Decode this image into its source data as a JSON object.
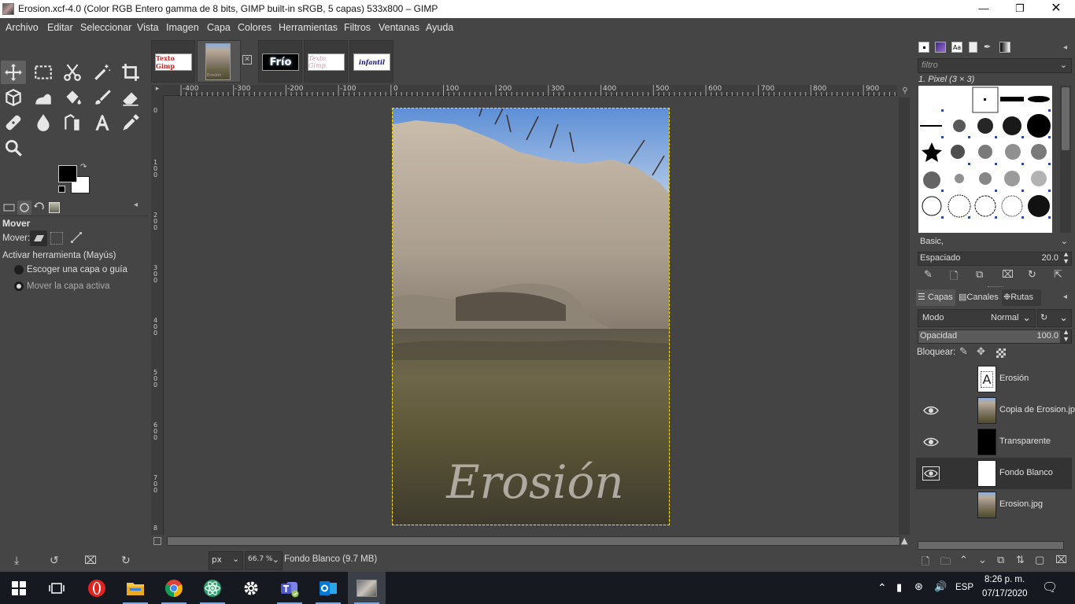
{
  "window": {
    "title": "Erosion.xcf-4.0 (Color RGB Entero gamma de 8 bits, GIMP built-in sRGB, 5 capas) 533x800 – GIMP",
    "minimize_icon": "minimize-icon",
    "maximize_icon": "restore-icon",
    "close_icon": "close-icon"
  },
  "menu": [
    "Archivo",
    "Editar",
    "Seleccionar",
    "Vista",
    "Imagen",
    "Capa",
    "Colores",
    "Herramientas",
    "Filtros",
    "Ventanas",
    "Ayuda"
  ],
  "toolbox": {
    "tools": [
      "move-tool-icon",
      "rect-select-icon",
      "scissors-select-icon",
      "fuzzy-select-icon",
      "crop-icon",
      "unified-transform-icon",
      "warp-transform-icon",
      "bucket-fill-icon",
      "paintbrush-icon",
      "eraser-icon",
      "heal-icon",
      "smudge-icon",
      "paths-icon",
      "text-tool-icon",
      "color-picker-icon",
      "zoom-icon"
    ],
    "fg_color": "#000000",
    "bg_color": "#ffffff"
  },
  "tool_options": {
    "title": "Mover",
    "mover_label": "Mover:",
    "activate_label": "Activar herramienta  (Mayús)",
    "option_pick": "Escoger una capa o guía",
    "option_active": "Mover la capa activa",
    "selected_option": "Mover la capa activa"
  },
  "image_tabs": {
    "tab1": "Texto Gimp",
    "tab2": "Erosión",
    "tab3": "Frío",
    "tab4": "Texto Gimp",
    "tab5": "infantil"
  },
  "rulers": {
    "h_ticks": [
      "-400",
      "-300",
      "-200",
      "-100",
      "0",
      "100",
      "200",
      "300",
      "400",
      "500",
      "600",
      "700",
      "800",
      "900"
    ],
    "v_ticks": [
      "0",
      "1\n0\n0",
      "2\n0\n0",
      "3\n0\n0",
      "4\n0\n0",
      "5\n0\n0",
      "6\n0\n0",
      "7\n0\n0",
      "8"
    ]
  },
  "canvas": {
    "overlay_text": "Erosión"
  },
  "statusbar": {
    "unit": "px",
    "zoom": "66.7 %",
    "info": "Fondo Blanco (9.7 MB)"
  },
  "brushes": {
    "filter_placeholder": "filtro",
    "current_brush": "1. Pixel (3 × 3)",
    "preset": "Basic,",
    "spacing_label": "Espaciado",
    "spacing_value": "20.0"
  },
  "layers_panel": {
    "tabs": [
      "Capas",
      "Canales",
      "Rutas"
    ],
    "mode_label": "Modo",
    "mode_value": "Normal",
    "opacity_label": "Opacidad",
    "opacity_value": "100.0",
    "lock_label": "Bloquear:",
    "layers": [
      {
        "name": "Erosión",
        "visible": false,
        "kind": "text"
      },
      {
        "name": "Copia de Erosion.jpg",
        "visible": true,
        "kind": "photo"
      },
      {
        "name": "Transparente",
        "visible": true,
        "kind": "black"
      },
      {
        "name": "Fondo Blanco",
        "visible": true,
        "kind": "white",
        "selected": true
      },
      {
        "name": "Erosion.jpg",
        "visible": false,
        "kind": "photo"
      }
    ]
  },
  "taskbar": {
    "apps": [
      "windows-start-icon",
      "task-view-icon",
      "opera-icon",
      "file-explorer-icon",
      "chrome-icon",
      "atom-icon",
      "settings-icon",
      "teams-icon",
      "outlook-icon",
      "gimp-icon"
    ],
    "language": "ESP",
    "time": "8:26 p. m.",
    "date": "07/17/2020"
  }
}
